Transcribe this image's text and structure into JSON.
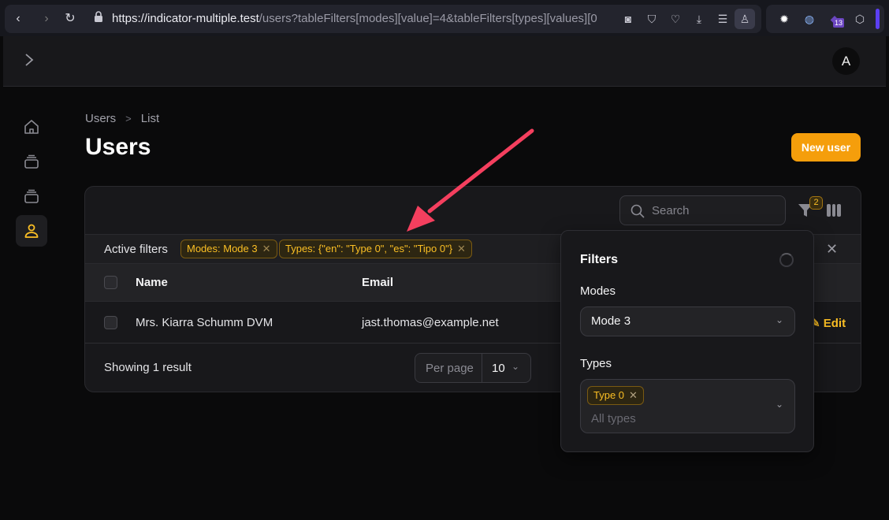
{
  "browser": {
    "url_host": "https://indicator-multiple.test",
    "url_path": "/users?tableFilters[modes][value]=4&tableFilters[types][values][0",
    "extension_badge": "13"
  },
  "topbar": {
    "avatar_initial": "A"
  },
  "sidebar": {
    "items": [
      {
        "name": "home",
        "icon": "home-icon",
        "active": false
      },
      {
        "name": "collection-1",
        "icon": "archive-stack-icon",
        "active": false
      },
      {
        "name": "collection-2",
        "icon": "archive-stack-icon",
        "active": false
      },
      {
        "name": "users",
        "icon": "user-icon",
        "active": true
      }
    ]
  },
  "page": {
    "breadcrumb": [
      "Users",
      "List"
    ],
    "breadcrumb_separator": ">",
    "title": "Users",
    "new_button": "New user"
  },
  "table": {
    "search_placeholder": "Search",
    "filter_count": "2",
    "active_filters_label": "Active filters",
    "active_filters": [
      "Modes: Mode 3",
      "Types: {\"en\": \"Type 0\", \"es\": \"Tipo 0\"}"
    ],
    "columns": [
      "Name",
      "Email"
    ],
    "rows": [
      {
        "name": "Mrs. Kiarra Schumm DVM",
        "email": "jast.thomas@example.net",
        "action": "Edit"
      }
    ],
    "showing": "Showing 1 result",
    "per_page_label": "Per page",
    "per_page_value": "10"
  },
  "filters_panel": {
    "title": "Filters",
    "modes_label": "Modes",
    "modes_value": "Mode 3",
    "types_label": "Types",
    "types_selected": [
      "Type 0"
    ],
    "types_placeholder": "All types"
  },
  "colors": {
    "accent": "#f59e0b",
    "chip_text": "#fbbf24",
    "annotation_arrow": "#f43f5e"
  }
}
